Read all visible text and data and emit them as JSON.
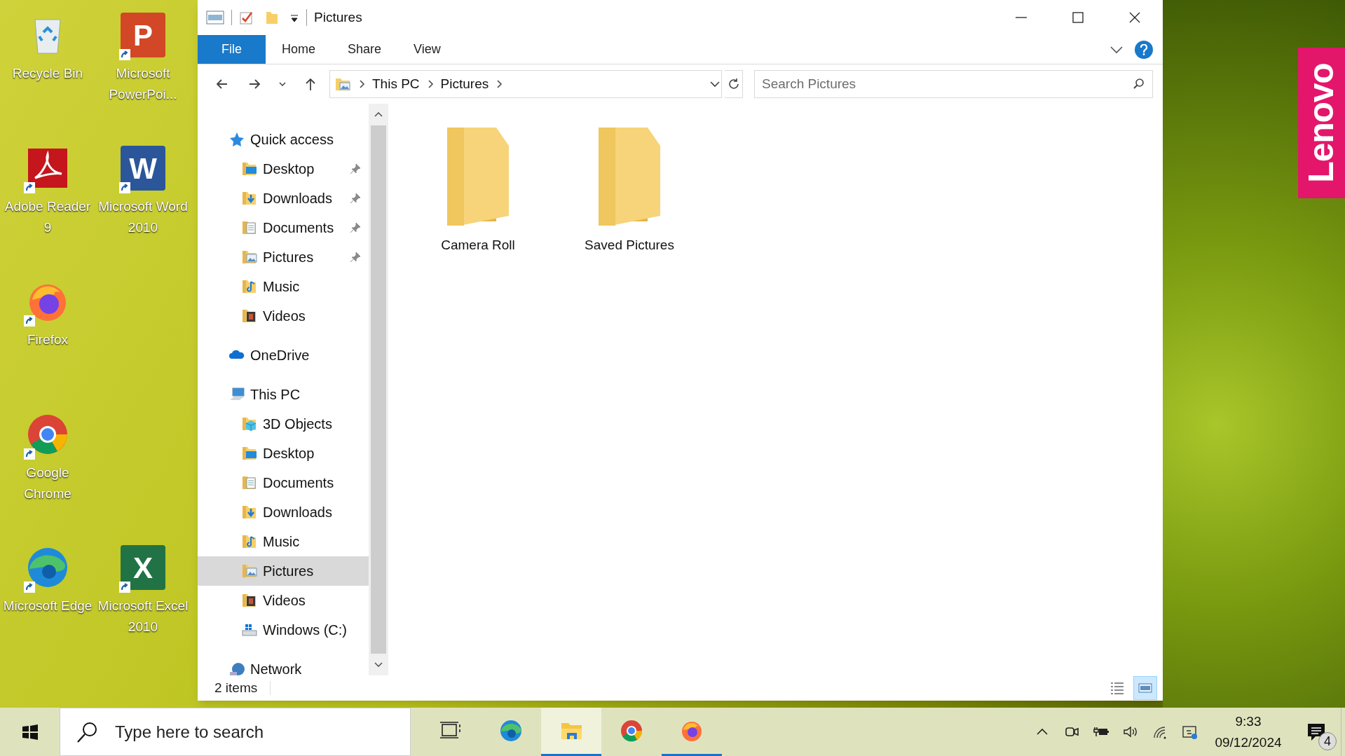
{
  "desktop": {
    "icons": [
      {
        "kind": "recycle-bin",
        "label": "Recycle Bin",
        "shortcut": false
      },
      {
        "kind": "powerpoint",
        "label": "Microsoft PowerPoi...",
        "logo_letter": "P",
        "shortcut": true
      },
      {
        "kind": "acrobat",
        "label": "Adobe Reader 9",
        "shortcut": true
      },
      {
        "kind": "word",
        "label": "Microsoft Word 2010",
        "logo_letter": "W",
        "shortcut": true
      },
      {
        "kind": "firefox",
        "label": "Firefox",
        "shortcut": true
      },
      {
        "kind": "chrome",
        "label": "Google Chrome",
        "shortcut": true
      },
      {
        "kind": "edge",
        "label": "Microsoft Edge",
        "shortcut": true
      },
      {
        "kind": "excel",
        "label": "Microsoft Excel 2010",
        "logo_letter": "X",
        "shortcut": true
      }
    ],
    "brand_tag": "Lenovo"
  },
  "window": {
    "title": "Pictures",
    "ribbon_tabs": [
      {
        "label": "File",
        "selected": true
      },
      {
        "label": "Home",
        "selected": false
      },
      {
        "label": "Share",
        "selected": false
      },
      {
        "label": "View",
        "selected": false
      }
    ],
    "address": {
      "path": [
        "This PC",
        "Pictures"
      ]
    },
    "search": {
      "placeholder": "Search Pictures"
    },
    "nav": [
      {
        "label": "Quick access",
        "kind": "star",
        "selected": false,
        "pinned": false,
        "children": [
          {
            "label": "Desktop",
            "kind": "desktop",
            "selected": false,
            "pinned": true
          },
          {
            "label": "Downloads",
            "kind": "downloads",
            "selected": false,
            "pinned": true
          },
          {
            "label": "Documents",
            "kind": "documents",
            "selected": false,
            "pinned": true
          },
          {
            "label": "Pictures",
            "kind": "pictures",
            "selected": false,
            "pinned": true
          },
          {
            "label": "Music",
            "kind": "music",
            "selected": false,
            "pinned": false
          },
          {
            "label": "Videos",
            "kind": "videos",
            "selected": false,
            "pinned": false
          }
        ]
      },
      {
        "label": "OneDrive",
        "kind": "cloud",
        "selected": false,
        "pinned": false
      },
      {
        "label": "This PC",
        "kind": "pc",
        "selected": false,
        "pinned": false,
        "children": [
          {
            "label": "3D Objects",
            "kind": "cube",
            "selected": false,
            "pinned": false
          },
          {
            "label": "Desktop",
            "kind": "desktop",
            "selected": false,
            "pinned": false
          },
          {
            "label": "Documents",
            "kind": "documents",
            "selected": false,
            "pinned": false
          },
          {
            "label": "Downloads",
            "kind": "downloads",
            "selected": false,
            "pinned": false
          },
          {
            "label": "Music",
            "kind": "music",
            "selected": false,
            "pinned": false
          },
          {
            "label": "Pictures",
            "kind": "pictures",
            "selected": true,
            "pinned": false
          },
          {
            "label": "Videos",
            "kind": "videos",
            "selected": false,
            "pinned": false
          },
          {
            "label": "Windows (C:)",
            "kind": "drive",
            "selected": false,
            "pinned": false
          }
        ]
      },
      {
        "label": "Network",
        "kind": "network",
        "selected": false,
        "pinned": false
      }
    ],
    "files": [
      {
        "label": "Camera Roll"
      },
      {
        "label": "Saved Pictures"
      }
    ],
    "status_bar": {
      "item_count": "2 items"
    },
    "view_buttons": [
      {
        "kind": "details",
        "selected": false
      },
      {
        "kind": "large-icons",
        "selected": true
      }
    ]
  },
  "taskbar": {
    "search": {
      "placeholder": "Type here to search"
    },
    "apps": [
      {
        "kind": "task-view",
        "running": false,
        "active": false
      },
      {
        "kind": "edge",
        "running": false,
        "active": false
      },
      {
        "kind": "explorer",
        "running": true,
        "active": true
      },
      {
        "kind": "chrome",
        "running": false,
        "active": false
      },
      {
        "kind": "firefox",
        "running": true,
        "active": false
      }
    ],
    "clock": {
      "time": "9:33",
      "date": "09/12/2024"
    },
    "notifications": {
      "count": "4"
    }
  }
}
